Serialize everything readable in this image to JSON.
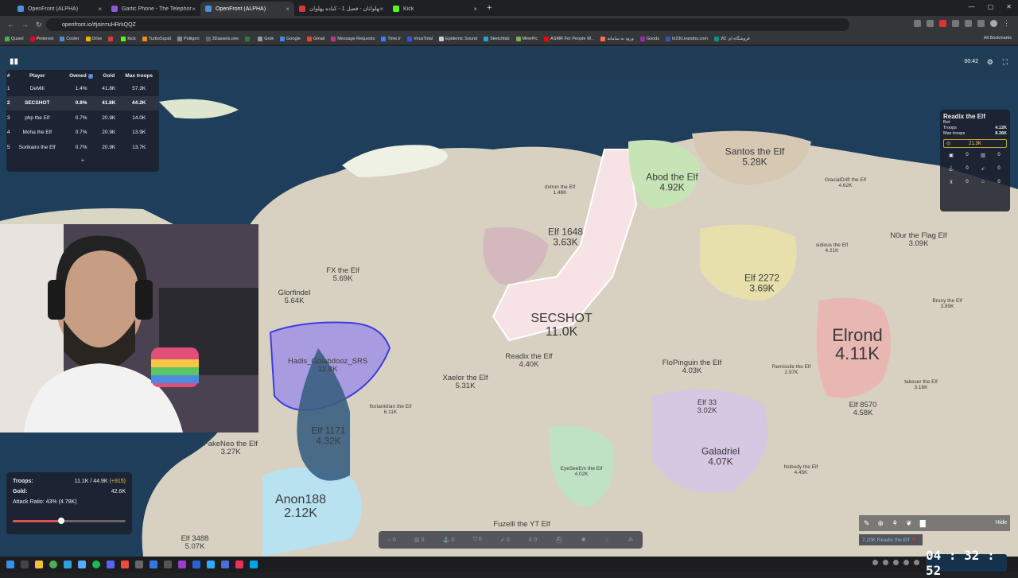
{
  "browser": {
    "tabs": [
      {
        "label": "OpenFront (ALPHA)",
        "color": "#4a90d9",
        "active": false
      },
      {
        "label": "Gartic Phone - The Telephone G",
        "color": "#8a5cd1",
        "active": false
      },
      {
        "label": "OpenFront (ALPHA)",
        "color": "#4a90d9",
        "active": true
      },
      {
        "label": "پهلوانان - فصل 1 - کباده پهلوان",
        "color": "#d43a3a",
        "active": false
      },
      {
        "label": "Kick",
        "color": "#53fc18",
        "active": false
      }
    ],
    "close_glyph": "×",
    "new_tab_glyph": "+",
    "url": "openfront.io/#join=uHRrkQQZ",
    "bookmarks": [
      {
        "label": "Quisel",
        "color": "#4caf50"
      },
      {
        "label": "Pinterest",
        "color": "#e60023"
      },
      {
        "label": "Cooler",
        "color": "#4a90d9"
      },
      {
        "label": "Drive",
        "color": "#f4b400"
      },
      {
        "label": "",
        "color": "#e53935"
      },
      {
        "label": "Kick",
        "color": "#53fc18"
      },
      {
        "label": "TurboSquid",
        "color": "#ff8a00"
      },
      {
        "label": "Poliigon",
        "color": "#888888"
      },
      {
        "label": "3Dassets.one",
        "color": "#666666"
      },
      {
        "label": "",
        "color": "#2e7d32"
      },
      {
        "label": "Grok",
        "color": "#999999"
      },
      {
        "label": "Google",
        "color": "#4285f4"
      },
      {
        "label": "Gmail",
        "color": "#ea4335"
      },
      {
        "label": "Message Requests",
        "color": "#c13584"
      },
      {
        "label": "Time.lr",
        "color": "#3b82f6"
      },
      {
        "label": "VirusTotal",
        "color": "#394eff"
      },
      {
        "label": "Epidemic Sound",
        "color": "#cccccc"
      },
      {
        "label": "Sketchfab",
        "color": "#1caad9"
      },
      {
        "label": "MinePic",
        "color": "#7cb342"
      },
      {
        "label": "ASMR For People W...",
        "color": "#ff0000"
      },
      {
        "label": "ورود به سامانه",
        "color": "#ff7043"
      },
      {
        "label": "Goods",
        "color": "#9c27b0"
      },
      {
        "label": "ln230.irandns.com",
        "color": "#3f51b5"
      },
      {
        "label": "فروشگاه ای کالا",
        "color": "#009688"
      }
    ],
    "all_bookmarks": "All Bookmarks"
  },
  "hud": {
    "timer": "00:42",
    "leaderboard": {
      "headers": [
        "#",
        "Player",
        "Owned",
        "Gold",
        "Max troops"
      ],
      "owned_badge": "↓",
      "rows": [
        {
          "rank": "1",
          "player": "DeMili",
          "owned": "1.4%",
          "gold": "41.8K",
          "troops": "57.3K",
          "me": false
        },
        {
          "rank": "2",
          "player": "SECSHOT",
          "owned": "0.8%",
          "gold": "41.8K",
          "troops": "44.2K",
          "me": true
        },
        {
          "rank": "3",
          "player": "php the Elf",
          "owned": "0.7%",
          "gold": "20.9K",
          "troops": "14.0K",
          "me": false
        },
        {
          "rank": "4",
          "player": "Moha the Elf",
          "owned": "0.7%",
          "gold": "20.9K",
          "troops": "13.9K",
          "me": false
        },
        {
          "rank": "5",
          "player": "Sorikairo the Elf",
          "owned": "0.7%",
          "gold": "20.9K",
          "troops": "13.7K",
          "me": false
        }
      ],
      "more": "+"
    },
    "player_info": {
      "name": "Readix the Elf",
      "type": "Bot",
      "troops_label": "Troops",
      "troops": "4.12K",
      "max_label": "Max troops",
      "max": "8.36K",
      "gold": "21.3K",
      "counts": [
        "0",
        "0",
        "0",
        "0",
        "0",
        "0"
      ]
    },
    "bottom_panel": {
      "troops_label": "Troops:",
      "troops_value": "11.1K / 44.9K",
      "troops_delta": "(+915)",
      "gold_label": "Gold:",
      "gold_value": "42.6K",
      "attack_ratio": "Attack Ratio: 43% (4.78K)",
      "attack_ratio_fraction": 0.43
    },
    "action_counts": [
      "0",
      "0",
      "0",
      "0",
      "0",
      "0"
    ],
    "hide": "Hide",
    "attack_notice": "7.20K Readix the Elf",
    "attack_close": "✕"
  },
  "map": {
    "territories": [
      {
        "name": "SECSHOT",
        "value": "11.0K",
        "size": "big",
        "color": "#f7e3e6"
      },
      {
        "name": "Elrond",
        "value": "4.11K",
        "size": "huge",
        "color": "#e8b7b2"
      },
      {
        "name": "Anon188",
        "value": "2.12K",
        "size": "big",
        "color": "#b8e2f0"
      },
      {
        "name": "Santos the Elf",
        "value": "5.28K",
        "size": "med",
        "color": "#d7c8b4"
      },
      {
        "name": "Abod the Elf",
        "value": "4.92K",
        "size": "med",
        "color": "#c7e4b7"
      },
      {
        "name": "Elf 1648",
        "value": "3.63K",
        "size": "med",
        "color": "#d3b8bd"
      },
      {
        "name": "Elf 2272",
        "value": "3.69K",
        "size": "med",
        "color": "#e7e0ac"
      },
      {
        "name": "N0ur the Flag Elf",
        "value": "3.09K",
        "size": "sm",
        "color": "#bfd4e8"
      },
      {
        "name": "Glorfindel",
        "value": "5.64K",
        "size": "sm",
        "color": "#c9c4b8"
      },
      {
        "name": "Hadis_Golabdooz_SRS",
        "value": "12.8K",
        "size": "sm",
        "color": "#a89be0"
      },
      {
        "name": "Elf 1171",
        "value": "4.32K",
        "size": "med",
        "color": "#c6d0df"
      },
      {
        "name": "FakeNeo the Elf",
        "value": "3.27K",
        "size": "sm",
        "color": "#d9e0c0"
      },
      {
        "name": "Galadriel",
        "value": "4.07K",
        "size": "med",
        "color": "#d6c7e2"
      },
      {
        "name": "Elf 33",
        "value": "3.02K",
        "size": "sm",
        "color": "#cfe4c1"
      },
      {
        "name": "Elf 8570",
        "value": "4.58K",
        "size": "sm",
        "color": "#d8cfe6"
      },
      {
        "name": "FloPinguin the Elf",
        "value": "4.03K",
        "size": "sm",
        "color": "#d0cfe2"
      },
      {
        "name": "Xaelor the Elf",
        "value": "5.31K",
        "size": "sm",
        "color": "#c9bfa8"
      },
      {
        "name": "Readix the Elf",
        "value": "4.40K",
        "size": "sm",
        "color": "#c6dfb0"
      },
      {
        "name": "FX the Elf",
        "value": "5.69K",
        "size": "sm",
        "color": "#c0c8cc"
      },
      {
        "name": "Fuzelll the YT Elf",
        "value": "",
        "size": "sm",
        "color": "#d6cfc0"
      },
      {
        "name": "Elf 3488",
        "value": "5.07K",
        "size": "sm",
        "color": "#e4e3c4"
      },
      {
        "name": "takeser the Elf",
        "value": "3.16K",
        "size": "xs",
        "color": "#d0c0d8"
      },
      {
        "name": "Bruny the Elf",
        "value": "3.89K",
        "size": "xs",
        "color": "#d9c6e0"
      },
      {
        "name": "Remissile the Elf",
        "value": "2.97K",
        "size": "xs",
        "color": "#d8e0c4"
      },
      {
        "name": "sidious the Elf",
        "value": "4.21K",
        "size": "xs",
        "color": "#cde6c8"
      },
      {
        "name": "Nobody the Elf",
        "value": "4.45K",
        "size": "xs",
        "color": "#e0d0da"
      },
      {
        "name": "EyeSeeEm the Elf",
        "value": "4.02K",
        "size": "xs",
        "color": "#bfe2c4"
      },
      {
        "name": "floriankilian the Elf",
        "value": "6.11K",
        "size": "xs",
        "color": "#cdc6b6"
      },
      {
        "name": "GlacialDrift the Elf",
        "value": "4.62K",
        "size": "xs",
        "color": "#d9c4c8"
      },
      {
        "name": "dxtron the Elf",
        "value": "1.48K",
        "size": "xs",
        "color": "#b4d8b2"
      }
    ]
  },
  "overlay": {
    "clock": "04 : 32 : 52"
  }
}
